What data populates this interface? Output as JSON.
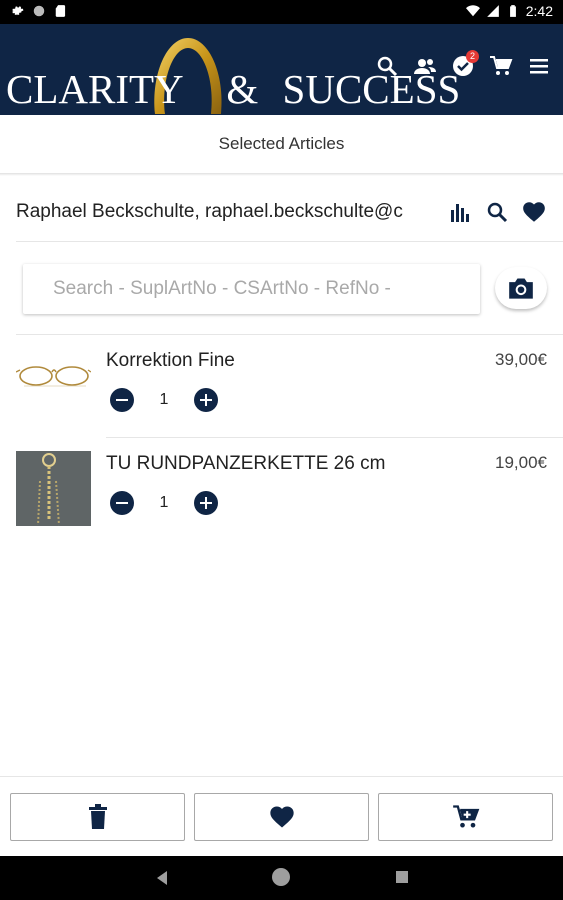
{
  "status_bar": {
    "time": "2:42",
    "icons": [
      "gear-icon",
      "circle-icon",
      "sd-card-icon",
      "wifi-icon",
      "signal-icon",
      "battery-icon"
    ]
  },
  "header": {
    "logo_text_left": "CLARITY",
    "logo_ampersand": "&",
    "logo_text_right": "SUCCESS",
    "icons": [
      "search-icon",
      "customers-icon",
      "tasks-check-icon",
      "cart-icon",
      "menu-icon"
    ],
    "tasks_badge": "2",
    "brand_color": "#0f2545",
    "ring_color": "#d4a017"
  },
  "page": {
    "title": "Selected Articles"
  },
  "customer": {
    "text": "Raphael Beckschulte, raphael.beckschulte@c"
  },
  "search": {
    "placeholder": "Search - SuplArtNo - CSArtNo - RefNo -",
    "value": ""
  },
  "items": [
    {
      "name": "Korrektion Fine",
      "price": "39,00€",
      "qty": "1",
      "thumb": "glasses"
    },
    {
      "name": "TU RUNDPANZERKETTE 26 cm",
      "price": "19,00€",
      "qty": "1",
      "thumb": "chain"
    }
  ],
  "bottom_actions": [
    "delete-icon",
    "favorite-icon",
    "add-to-cart-icon"
  ]
}
